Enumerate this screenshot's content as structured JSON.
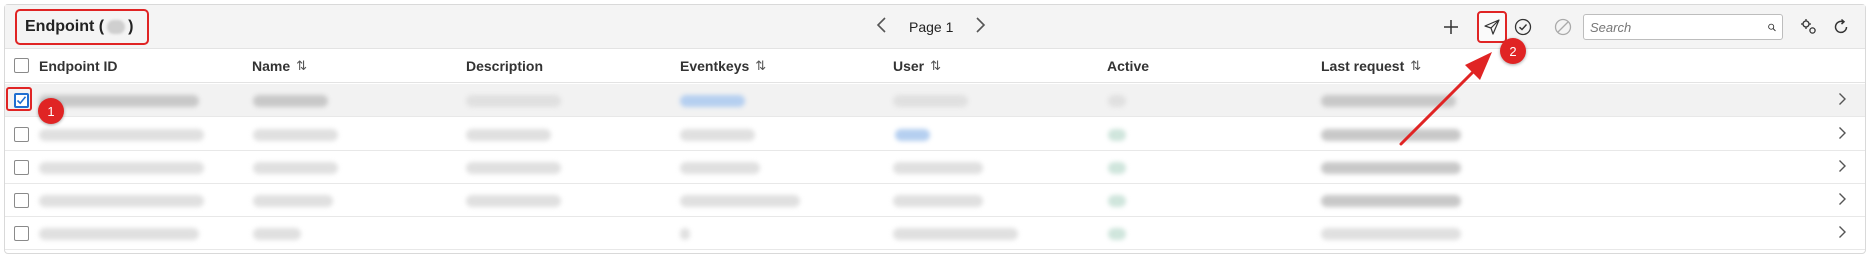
{
  "header": {
    "title": "Endpoint (",
    "title_close": ")",
    "pager_label": "Page 1",
    "prev_icon": "chevron-left-icon",
    "next_icon": "chevron-right-icon",
    "search_placeholder": "Search"
  },
  "toolbar": {
    "add_icon": "plus-icon",
    "send_icon": "paper-plane-icon",
    "activate_icon": "check-circle-icon",
    "deactivate_icon": "block-icon",
    "settings_icon": "settings-icon",
    "refresh_icon": "refresh-icon"
  },
  "columns": [
    {
      "label": "Endpoint ID",
      "sortable": false
    },
    {
      "label": "Name",
      "sortable": true
    },
    {
      "label": "Description",
      "sortable": false
    },
    {
      "label": "Eventkeys",
      "sortable": true
    },
    {
      "label": "User",
      "sortable": true
    },
    {
      "label": "Active",
      "sortable": false
    },
    {
      "label": "Last request",
      "sortable": true
    }
  ],
  "sort_glyph": "⇅",
  "rows": [
    {
      "selected": true
    },
    {
      "selected": false
    },
    {
      "selected": false
    },
    {
      "selected": false
    },
    {
      "selected": false
    }
  ],
  "annotations": {
    "badge1": "1",
    "badge2": "2"
  },
  "colors": {
    "annotation_red": "#e02424",
    "checkbox_blue": "#1f6fd1"
  }
}
